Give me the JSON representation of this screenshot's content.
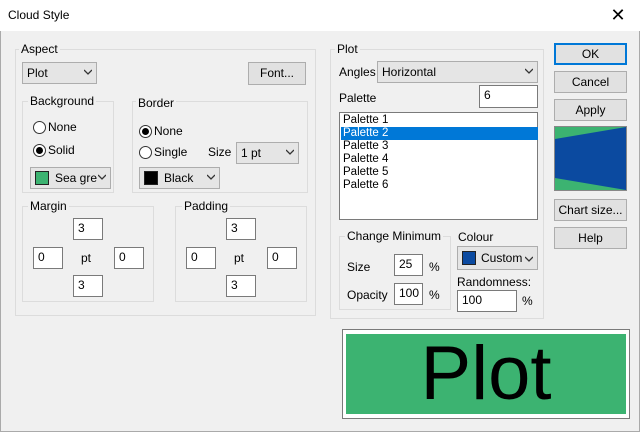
{
  "window": {
    "title": "Cloud Style",
    "close_glyph": "✕"
  },
  "aspect": {
    "label": "Aspect",
    "select_value": "Plot",
    "font_button": "Font...",
    "background": {
      "label": "Background",
      "none_label": "None",
      "solid_label": "Solid",
      "selected": "Solid",
      "color_value": "Sea gre",
      "color_hex": "#2e8b57"
    },
    "border": {
      "label": "Border",
      "none_label": "None",
      "single_label": "Single",
      "selected": "None",
      "size_label": "Size",
      "size_value": "1 pt",
      "color_value": "Black",
      "color_hex": "#000000"
    },
    "margin": {
      "label": "Margin",
      "top": "3",
      "left": "0",
      "right": "0",
      "bottom": "3",
      "unit": "pt"
    },
    "padding": {
      "label": "Padding",
      "top": "3",
      "left": "0",
      "right": "0",
      "bottom": "3",
      "unit": "pt"
    }
  },
  "plot": {
    "label": "Plot",
    "angles_label": "Angles",
    "angles_value": "Horizontal",
    "palette_label": "Palette",
    "palette_value": "6",
    "palette_items": [
      "Palette 1",
      "Palette 2",
      "Palette 3",
      "Palette 4",
      "Palette 5",
      "Palette 6"
    ],
    "selected_palette": "Palette 2",
    "change_minimum": {
      "label": "Change Minimum",
      "size_label": "Size",
      "size_value": "25",
      "opacity_label": "Opacity",
      "opacity_value": "100",
      "unit": "%"
    },
    "colour": {
      "label": "Colour",
      "value": "Custom",
      "hex": "#0b4aa0"
    },
    "randomness": {
      "label": "Randomness:",
      "value": "100",
      "unit": "%"
    }
  },
  "buttons": {
    "ok": "OK",
    "cancel": "Cancel",
    "apply": "Apply",
    "chart_size": "Chart size...",
    "help": "Help"
  },
  "preview": {
    "text": "Plot",
    "bg_hex": "#3cb371",
    "shape_hex": "#0b4aa0"
  }
}
